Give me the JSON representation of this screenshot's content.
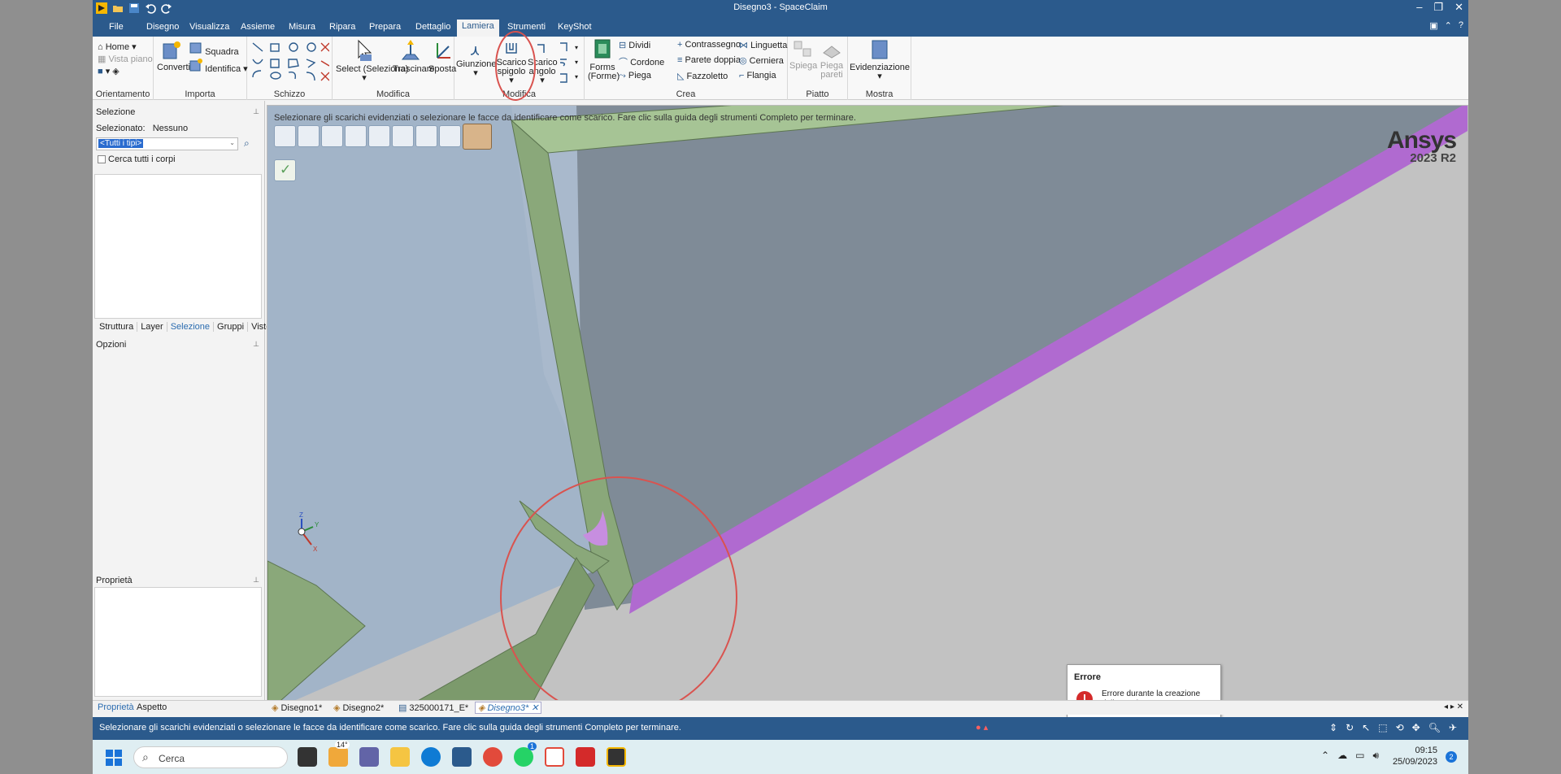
{
  "window": {
    "title": "Disegno3 - SpaceClaim"
  },
  "menu": {
    "tabs": [
      "File",
      "Disegno",
      "Visualizza",
      "Assieme",
      "Misura",
      "Ripara",
      "Prepara",
      "Dettaglio",
      "Lamiera",
      "Strumenti",
      "KeyShot"
    ],
    "active": "Lamiera"
  },
  "ribbon": {
    "orientamento": {
      "label": "Orientamento",
      "home": "Home",
      "vista_piano": "Vista piano"
    },
    "importa": {
      "label": "Importa",
      "converti": "Converti",
      "squadra": "Squadra",
      "identifica": "Identifica"
    },
    "schizzo": {
      "label": "Schizzo"
    },
    "modifica1": {
      "label": "Modifica",
      "select": "Select (Seleziona)",
      "trascinare": "Trascinare",
      "sposta": "Sposta"
    },
    "modifica2": {
      "label": "Modifica",
      "giunzione": "Giunzione",
      "scarico_spigolo_1": "Scarico",
      "scarico_spigolo_2": "spigolo",
      "scarico_angolo_1": "Scarico",
      "scarico_angolo_2": "angolo"
    },
    "crea": {
      "label": "Crea",
      "forms_1": "Forms",
      "forms_2": "(Forme)",
      "dividi": "Dividi",
      "cordone": "Cordone",
      "piega": "Piega",
      "contrassegno": "Contrassegno",
      "parete_doppia": "Parete doppia",
      "fazzoletto": "Fazzoletto",
      "linguetta": "Linguetta",
      "cerniera": "Cerniera",
      "flangia": "Flangia"
    },
    "piatto": {
      "label": "Piatto",
      "spiega": "Spiega",
      "piega_pareti_1": "Piega",
      "piega_pareti_2": "pareti"
    },
    "mostra": {
      "label": "Mostra",
      "evidenziazione": "Evidenziazione"
    }
  },
  "left_panel": {
    "selezione_title": "Selezione",
    "selezionato_label": "Selezionato:",
    "selezionato_value": "Nessuno",
    "filter_value": "<Tutti i tipi>",
    "cerca_checkbox": "Cerca tutti i corpi",
    "tabs": [
      "Struttura",
      "Layer",
      "Selezione",
      "Gruppi",
      "Viste"
    ],
    "opzioni_title": "Opzioni",
    "proprieta_title": "Proprietà",
    "bottom_tabs": [
      "Proprietà",
      "Aspetto"
    ]
  },
  "viewport": {
    "hint": "Selezionare gli scarichi evidenziati o selezionare le facce da identificare come scarico. Fare clic sulla guida degli strumenti Completo per terminare.",
    "brand": "Ansys",
    "version": "2023 R2",
    "axis_z": "Z",
    "axis_y": "Y",
    "axis_x": "X"
  },
  "error_popup": {
    "title": "Errore",
    "message": "Errore durante la creazione dello scarico."
  },
  "doc_tabs": [
    "Disegno1*",
    "Disegno2*",
    "325000171_E*",
    "Disegno3*"
  ],
  "status": {
    "text": "Selezionare gli scarichi evidenziati o selezionare le facce da identificare come scarico. Fare clic sulla guida degli strumenti Completo per terminare."
  },
  "taskbar": {
    "search": "Cerca",
    "weather": "14°",
    "whatsapp_badge": "1",
    "time": "09:15",
    "date": "25/09/2023",
    "notif_count": "2"
  },
  "colors": {
    "accent": "#2b5a8c",
    "sheet_green": "#8aa87a",
    "edge_purple": "#b06ad0",
    "highlight_red": "#d9534f"
  }
}
